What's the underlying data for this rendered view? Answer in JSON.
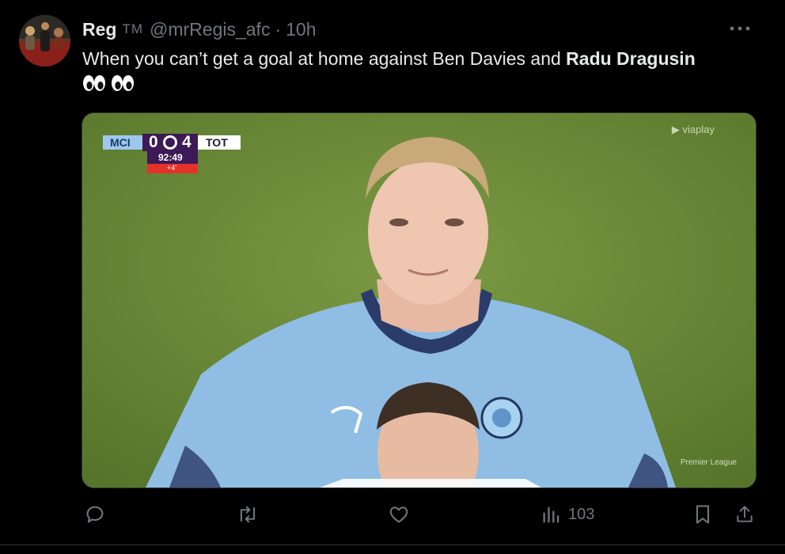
{
  "tweet": {
    "display_name": "Reg",
    "badge": "TM",
    "handle": "@mrRegis_afc",
    "separator": "·",
    "time": "10h",
    "text_plain": "When you can’t get a goal at home against Ben Davies and ",
    "text_bold": "Radu Dragusin",
    "emoji_icons": [
      "eyes-emoji",
      "eyes-emoji"
    ]
  },
  "media": {
    "scorebug": {
      "home": "MCI",
      "home_score": "0",
      "away_score": "4",
      "away": "TOT",
      "clock": "92:49",
      "added_time": "+4'"
    },
    "broadcaster": "viaplay",
    "league_mark": "Premier League",
    "colors": {
      "pitch": "#6a8a35",
      "kit": "#8fbde4",
      "home_tag": "#9ec7ee",
      "clock_box": "#3d1a55",
      "added_box": "#e4322b"
    }
  },
  "actions": {
    "reply_icon": "reply-icon",
    "retweet_icon": "retweet-icon",
    "like_icon": "heart-icon",
    "views_icon": "views-icon",
    "views_count": "103",
    "bookmark_icon": "bookmark-icon",
    "share_icon": "share-icon"
  },
  "more_icon": "more-dots-icon"
}
